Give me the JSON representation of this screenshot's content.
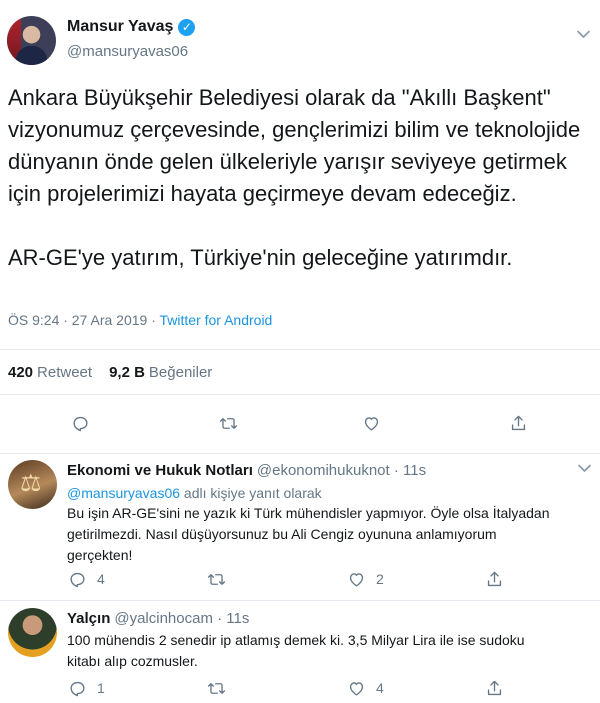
{
  "main_tweet": {
    "display_name": "Mansur Yavaş",
    "verified_glyph": "✓",
    "handle": "@mansuryavas06",
    "text": "Ankara Büyükşehir Belediyesi olarak da \"Akıllı Başkent\" vizyonumuz çerçevesinde, gençlerimizi bilim ve teknolojide dünyanın önde gelen ülkeleriyle yarışır seviyeye getirmek için projelerimizi hayata geçirmeye devam edeceğiz.\n\nAR-GE'ye yatırım, Türkiye'nin geleceğine yatırımdır.",
    "timestamp": "ÖS 9:24 · 27 Ara 2019 · ",
    "source": "Twitter for Android",
    "retweet_count": "420",
    "retweet_label": "Retweet",
    "like_count": "9,2 B",
    "like_label": "Beğeniler"
  },
  "replies": [
    {
      "display_name": "Ekonomi ve Hukuk Notları",
      "handle": "@ekonomihukuknot · 11s",
      "reply_to_mention": "@mansuryavas06",
      "reply_to_suffix": " adlı kişiye yanıt olarak",
      "text": "Bu işin AR-GE'sini ne yazık ki Türk mühendisler yapmıyor. Öyle olsa İtalyadan\ngetirilmezdi. Nasıl düşüyorsunuz bu Ali Cengiz oyununa anlamıyorum\ngerçekten!",
      "reply_count": "4",
      "retweet_count": "",
      "like_count": "2"
    },
    {
      "display_name": "Yalçın",
      "handle": "@yalcinhocam · 11s",
      "text": "100 mühendis 2 senedir ip atlamış demek ki. 3,5 Milyar Lira ile ise sudoku\nkitabı alıp cozmusler.",
      "reply_count": "1",
      "retweet_count": "",
      "like_count": "4"
    }
  ],
  "icons": {
    "reply": "reply-icon",
    "retweet": "retweet-icon",
    "like": "heart-icon",
    "share": "share-icon",
    "caret": "chevron-down-icon"
  },
  "colors": {
    "link": "#1b95e0",
    "verified": "#1da1f2",
    "muted": "#657786",
    "divider": "#e6ecf0"
  }
}
